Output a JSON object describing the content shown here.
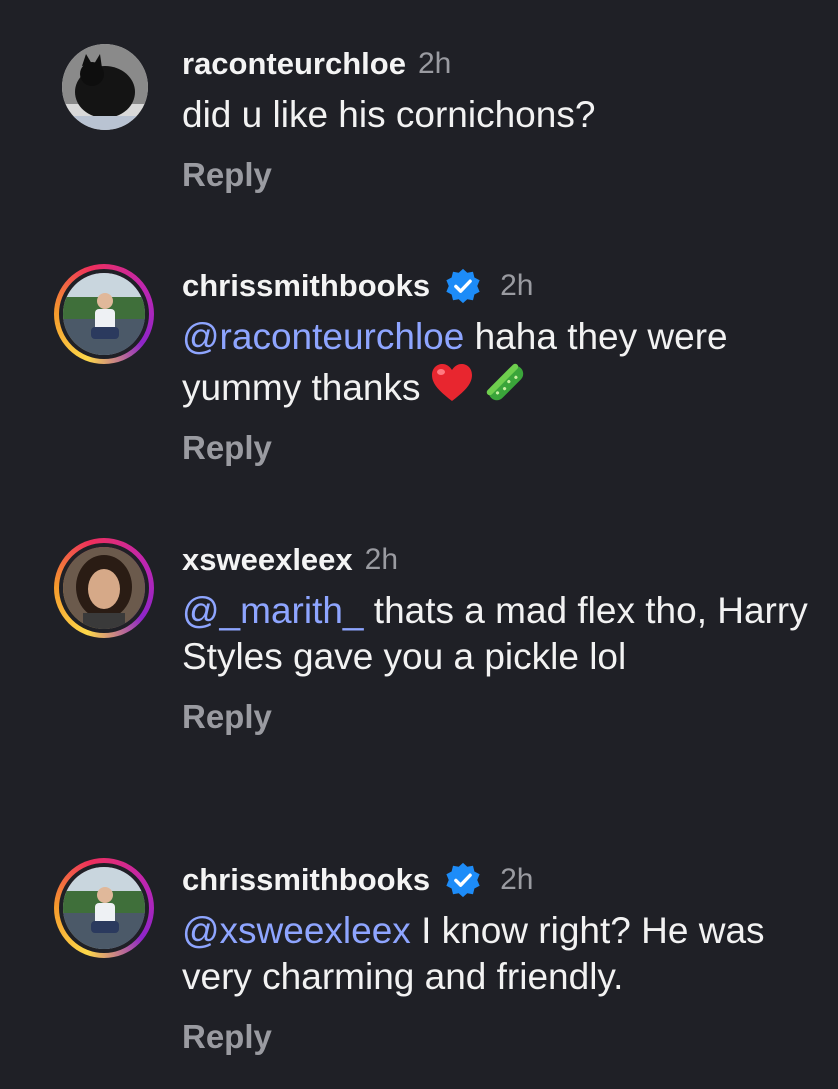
{
  "comments": [
    {
      "username": "raconteurchloe",
      "time": "2h",
      "verified": false,
      "mention": "",
      "text": "did u like his cornichons?",
      "reply_label": "Reply"
    },
    {
      "username": "chrissmithbooks",
      "time": "2h",
      "verified": true,
      "mention": "@raconteurchloe",
      "text": " haha they were yummy thanks",
      "emojis": [
        "red-heart",
        "cucumber"
      ],
      "reply_label": "Reply"
    },
    {
      "username": "xsweexleex",
      "time": "2h",
      "verified": false,
      "mention": "@_marith_",
      "text": " thats a mad flex tho, Harry Styles gave you a pickle lol",
      "reply_label": "Reply"
    },
    {
      "username": "chrissmithbooks",
      "time": "2h",
      "verified": true,
      "mention": "@xsweexleex",
      "text": " I know right? He was very charming and friendly.",
      "reply_label": "Reply"
    }
  ],
  "colors": {
    "background": "#1f2026",
    "mention": "#8ea5ff",
    "verified": "#1d8cf8",
    "muted": "#9a9ba1"
  }
}
